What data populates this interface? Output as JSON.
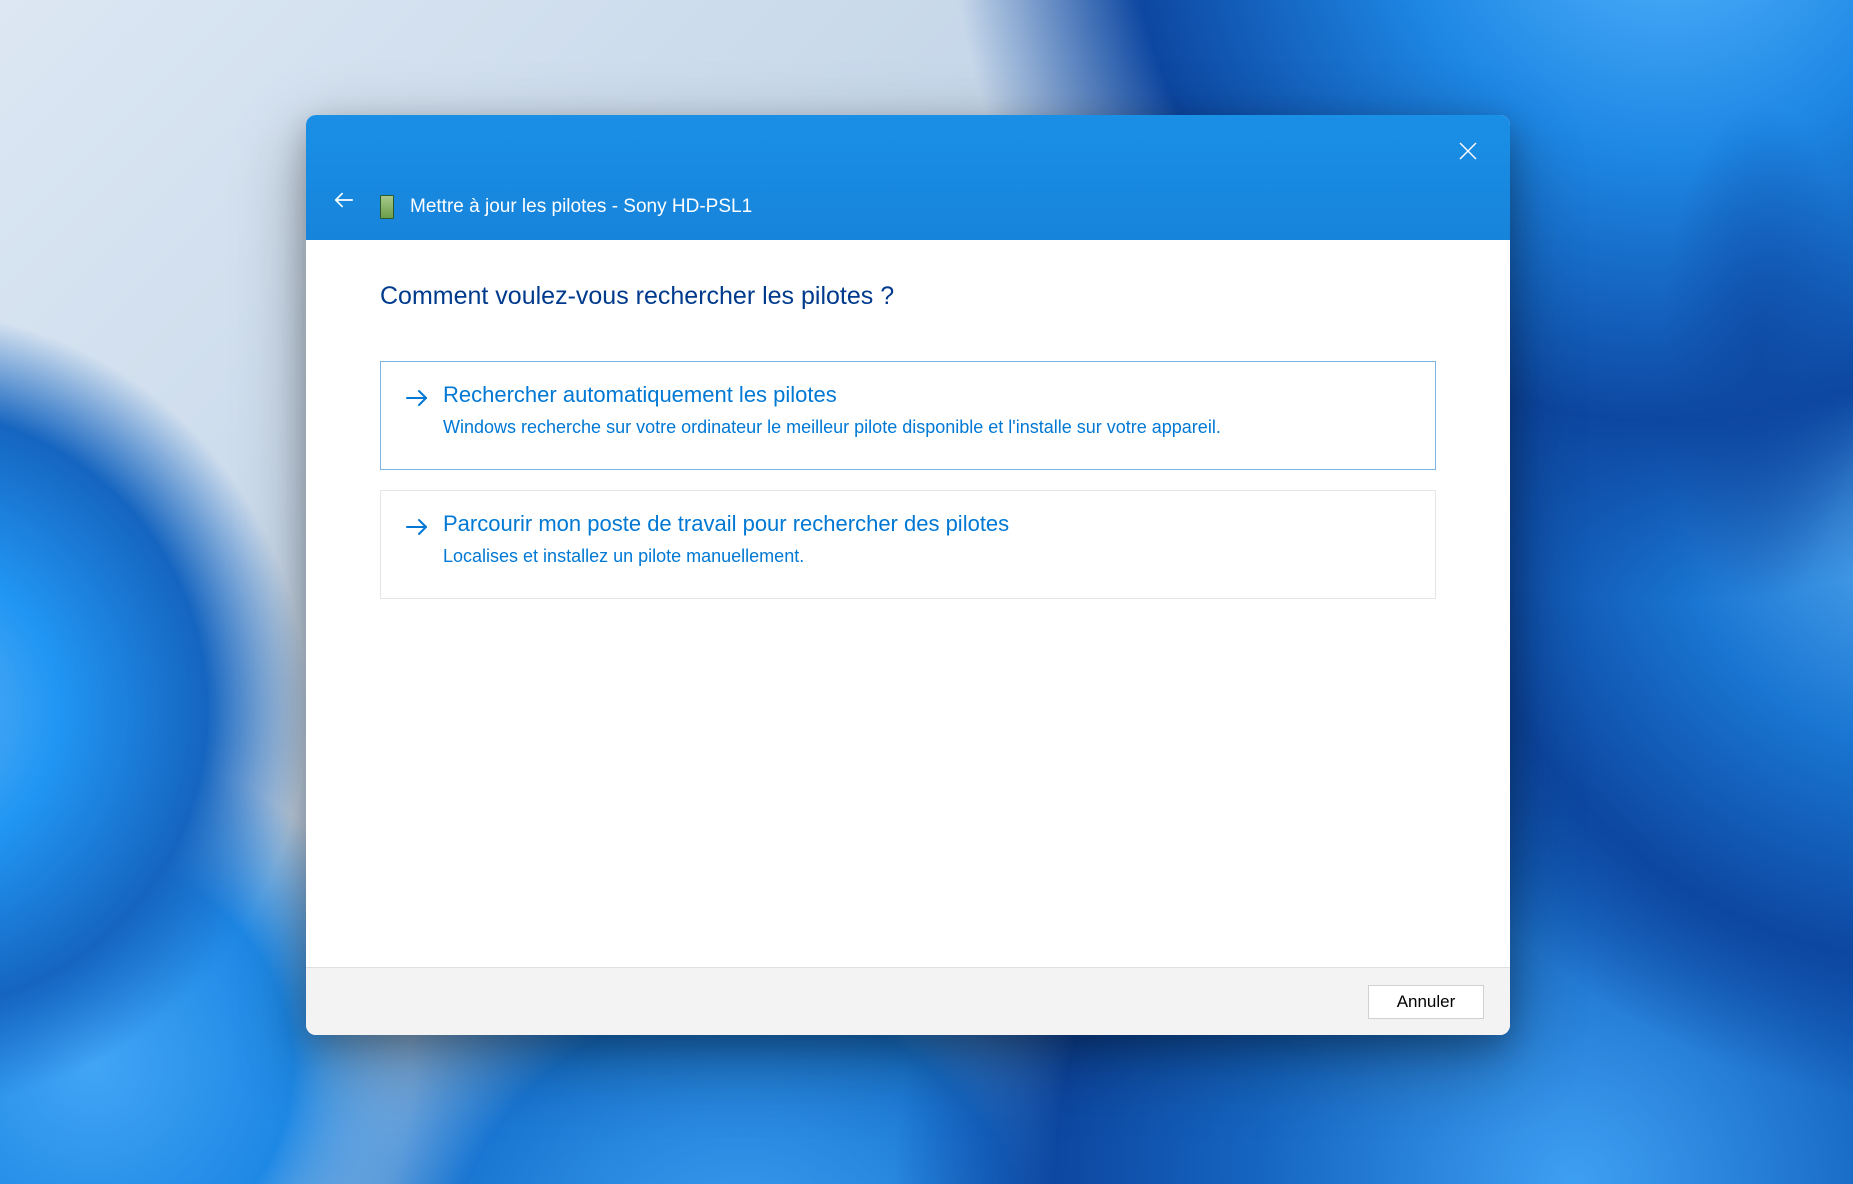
{
  "titlebar": {
    "title": "Mettre à jour les pilotes - Sony HD-PSL1"
  },
  "content": {
    "heading": "Comment voulez-vous rechercher les pilotes ?",
    "options": [
      {
        "title": "Rechercher automatiquement les pilotes",
        "description": "Windows recherche sur votre ordinateur le meilleur pilote disponible et l'installe sur votre appareil."
      },
      {
        "title": "Parcourir mon poste de travail pour rechercher des pilotes",
        "description": "Localises et installez un pilote manuellement."
      }
    ]
  },
  "footer": {
    "cancel": "Annuler"
  }
}
